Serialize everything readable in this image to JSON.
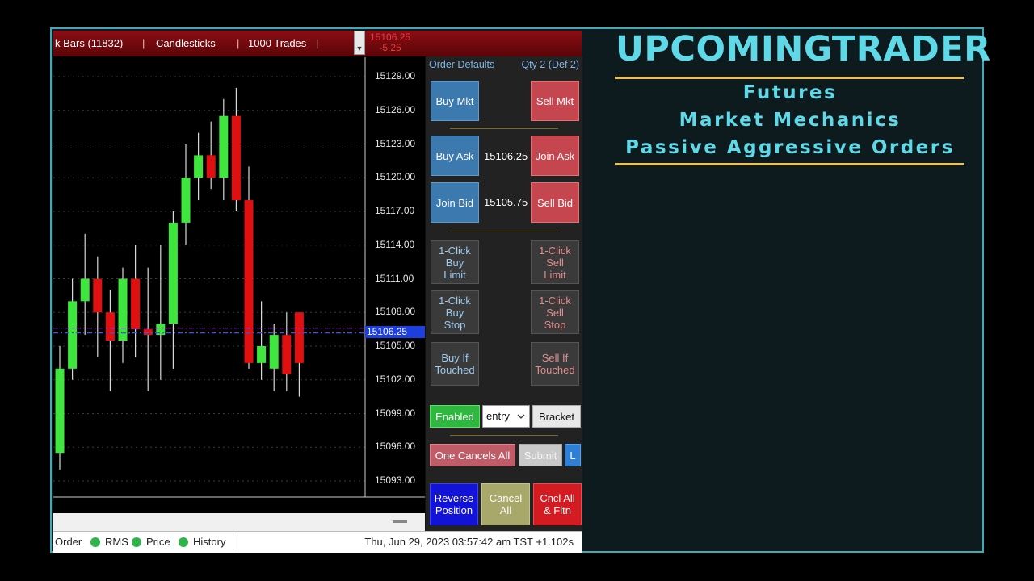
{
  "toolbar": {
    "bars_label": "k Bars (11832)",
    "style_label": "Candlesticks",
    "trades_label": "1000 Trades",
    "sep": "|",
    "scroll_glyph": "▼",
    "overlay_price": "15106.25",
    "overlay_change": "-5.25"
  },
  "chart": {
    "price_ticks": [
      "15129.00",
      "15126.00",
      "15123.00",
      "15120.00",
      "15117.00",
      "15114.00",
      "15111.00",
      "15108.00",
      "15105.00",
      "15102.00",
      "15099.00",
      "15096.00",
      "15093.00"
    ],
    "last_price": "15106.25",
    "colors": {
      "up": "#3ee63e",
      "down": "#e01010",
      "wick": "#d8d8d8",
      "grid": "#3a3a3a",
      "bid_line": "#3c5ad8",
      "ask_line": "#9c3cc8"
    }
  },
  "chart_data": {
    "type": "candlestick",
    "x": [
      "1",
      "2",
      "3",
      "4",
      "5",
      "6",
      "7",
      "8",
      "9",
      "10",
      "11",
      "12",
      "13",
      "14",
      "15",
      "16",
      "17",
      "18",
      "19",
      "20"
    ],
    "open": [
      15095.5,
      15103.0,
      15109.0,
      15111.0,
      15108.0,
      15105.5,
      15111.0,
      15106.5,
      15106.0,
      15107.0,
      15116.0,
      15120.0,
      15122.0,
      15120.0,
      15125.5,
      15118.0,
      15103.5,
      15103.0,
      15106.0,
      15108.0
    ],
    "close": [
      15103.0,
      15109.0,
      15111.0,
      15108.0,
      15105.5,
      15111.0,
      15106.5,
      15106.0,
      15107.0,
      15116.0,
      15120.0,
      15122.0,
      15120.0,
      15125.5,
      15118.0,
      15103.5,
      15105.0,
      15106.0,
      15102.5,
      15103.5
    ],
    "high": [
      15105.0,
      15111.0,
      15115.0,
      15113.0,
      15110.0,
      15112.0,
      15114.0,
      15112.0,
      15114.0,
      15117.0,
      15123.0,
      15124.0,
      15125.0,
      15127.0,
      15128.0,
      15121.0,
      15109.0,
      15107.0,
      15108.0,
      15108.0
    ],
    "low": [
      15094.0,
      15102.0,
      15106.0,
      15104.0,
      15101.0,
      15103.5,
      15104.0,
      15101.0,
      15102.0,
      15103.0,
      15114.0,
      15118.0,
      15119.0,
      15118.0,
      15117.0,
      15103.0,
      15102.0,
      15101.0,
      15101.0,
      15100.5
    ],
    "ylim": [
      15091.5,
      15130.5
    ]
  },
  "panel": {
    "header_left": "Order Defaults",
    "header_right": "Qty 2 (Def 2)",
    "buy_mkt": "Buy Mkt",
    "sell_mkt": "Sell Mkt",
    "buy_ask": "Buy Ask",
    "ask_price": "15106.25",
    "join_ask": "Join Ask",
    "join_bid": "Join Bid",
    "bid_price": "15105.75",
    "sell_bid": "Sell Bid",
    "oneclick_buy_limit": [
      "1-Click",
      "Buy",
      "Limit"
    ],
    "oneclick_sell_limit": [
      "1-Click",
      "Sell",
      "Limit"
    ],
    "oneclick_buy_stop": [
      "1-Click",
      "Buy",
      "Stop"
    ],
    "oneclick_sell_stop": [
      "1-Click",
      "Sell",
      "Stop"
    ],
    "buy_if_touched": [
      "Buy If",
      "Touched"
    ],
    "sell_if_touched": [
      "Sell If",
      "Touched"
    ],
    "enabled": "Enabled",
    "entry_value": "entry",
    "bracket": "Bracket",
    "one_cancels_all": "One Cancels All",
    "submit": "Submit",
    "l_button": "L",
    "reverse_position": [
      "Reverse",
      "Position"
    ],
    "cancel_all": [
      "Cancel",
      "All"
    ],
    "cncl_all_fltn": [
      "Cncl All",
      "& Fltn"
    ]
  },
  "statusbar": {
    "order": "Order",
    "rms": "RMS",
    "price": "Price",
    "history": "History",
    "timestamp": "Thu, Jun 29, 2023 03:57:42 am TST +1.102s"
  },
  "brand": {
    "title": "UPCOMINGTRADER",
    "line1": "Futures",
    "line2": "Market Mechanics",
    "line3": "Passive Aggressive Orders",
    "accent": "#5fd8e8",
    "gold": "#e8c060"
  }
}
